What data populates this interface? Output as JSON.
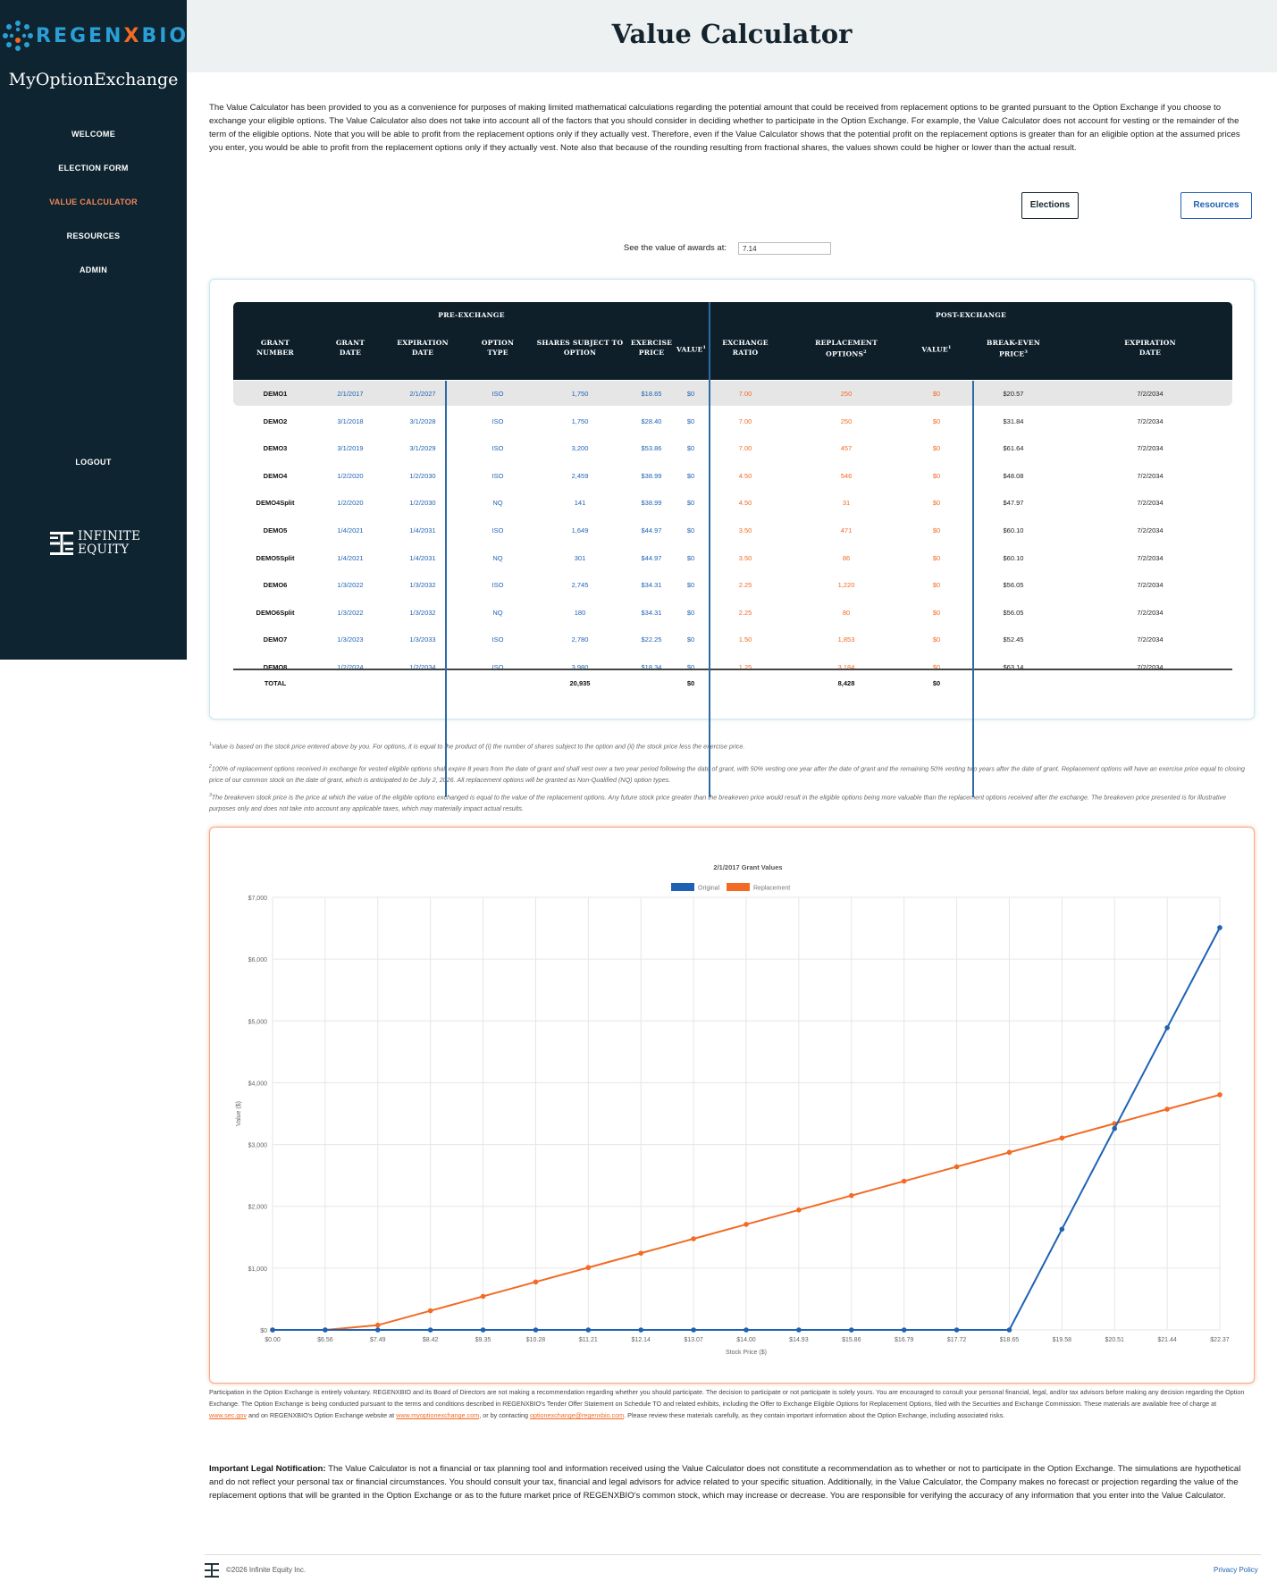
{
  "brand": {
    "logo_text_a": "REGEN",
    "logo_text_b": "X",
    "logo_text_c": "BIO",
    "app_name": "MyOptionExchange",
    "partner_line1": "INFINITE",
    "partner_line2": "EQUITY",
    "accent_blue": "#1f62b4",
    "accent_orange": "#f26a24",
    "sidebar_bg": "#0e2430"
  },
  "nav": {
    "items": [
      {
        "label": "WELCOME",
        "active": false
      },
      {
        "label": "ELECTION FORM",
        "active": false
      },
      {
        "label": "VALUE CALCULATOR",
        "active": true
      },
      {
        "label": "RESOURCES",
        "active": false
      },
      {
        "label": "ADMIN",
        "active": false
      }
    ],
    "logout": "LOGOUT"
  },
  "page": {
    "title": "Value Calculator",
    "intro": "The Value Calculator has been provided to you as a convenience for purposes of making limited mathematical calculations regarding the potential amount that could be received from replacement options to be granted pursuant to the Option Exchange if you choose to exchange your eligible options. The Value Calculator also does not take into account all of the factors that you should consider in deciding whether to participate in the Option Exchange. For example, the Value Calculator does not account for vesting or the remainder of the term of the eligible options. Note that you will be able to profit from the replacement options only if they actually vest. Therefore, even if the Value Calculator shows that the potential profit on the replacement options is greater than for an eligible option at the assumed prices you enter, you would be able to profit from the replacement options only if they actually vest. Note also that because of the rounding resulting from fractional shares, the values shown could be higher or lower than the actual result.",
    "elections_button": "Elections",
    "resources_button": "Resources",
    "see_value_label": "See the value of awards at:",
    "price_value": "7.14"
  },
  "table": {
    "group_pre": "PRE-EXCHANGE",
    "group_post": "POST-EXCHANGE",
    "headers": {
      "grant_number_1": "GRANT",
      "grant_number_2": "NUMBER",
      "grant_date_1": "GRANT",
      "grant_date_2": "DATE",
      "expiration_1": "EXPIRATION",
      "expiration_2": "DATE",
      "option_type_1": "OPTION",
      "option_type_2": "TYPE",
      "shares_1": "SHARES SUBJECT TO",
      "shares_2": "OPTION",
      "exercise_1": "EXERCISE",
      "exercise_2": "PRICE",
      "value_pre": "VALUE",
      "ratio_1": "EXCHANGE",
      "ratio_2": "RATIO",
      "replacement_1": "REPLACEMENT",
      "replacement_2": "OPTIONS",
      "value_post": "VALUE",
      "breakeven_1": "BREAK-EVEN",
      "breakeven_2": "PRICE",
      "post_exp_1": "EXPIRATION",
      "post_exp_2": "DATE"
    },
    "rows": [
      {
        "grant": "DEMO1",
        "grant_date": "2/1/2017",
        "exp_date": "2/1/2027",
        "type": "ISO",
        "shares": "1,750",
        "exercise": "$18.65",
        "value": "$0",
        "ratio": "7.00",
        "replacement": "250",
        "post_value": "$0",
        "breakeven": "$20.57",
        "post_exp": "7/2/2034"
      },
      {
        "grant": "DEMO2",
        "grant_date": "3/1/2018",
        "exp_date": "3/1/2028",
        "type": "ISO",
        "shares": "1,750",
        "exercise": "$28.40",
        "value": "$0",
        "ratio": "7.00",
        "replacement": "250",
        "post_value": "$0",
        "breakeven": "$31.84",
        "post_exp": "7/2/2034"
      },
      {
        "grant": "DEMO3",
        "grant_date": "3/1/2019",
        "exp_date": "3/1/2029",
        "type": "ISO",
        "shares": "3,200",
        "exercise": "$53.86",
        "value": "$0",
        "ratio": "7.00",
        "replacement": "457",
        "post_value": "$0",
        "breakeven": "$61.64",
        "post_exp": "7/2/2034"
      },
      {
        "grant": "DEMO4",
        "grant_date": "1/2/2020",
        "exp_date": "1/2/2030",
        "type": "ISO",
        "shares": "2,459",
        "exercise": "$38.99",
        "value": "$0",
        "ratio": "4.50",
        "replacement": "546",
        "post_value": "$0",
        "breakeven": "$48.08",
        "post_exp": "7/2/2034"
      },
      {
        "grant": "DEMO4Split",
        "grant_date": "1/2/2020",
        "exp_date": "1/2/2030",
        "type": "NQ",
        "shares": "141",
        "exercise": "$38.99",
        "value": "$0",
        "ratio": "4.50",
        "replacement": "31",
        "post_value": "$0",
        "breakeven": "$47.97",
        "post_exp": "7/2/2034"
      },
      {
        "grant": "DEMO5",
        "grant_date": "1/4/2021",
        "exp_date": "1/4/2031",
        "type": "ISO",
        "shares": "1,649",
        "exercise": "$44.97",
        "value": "$0",
        "ratio": "3.50",
        "replacement": "471",
        "post_value": "$0",
        "breakeven": "$60.10",
        "post_exp": "7/2/2034"
      },
      {
        "grant": "DEMO5Split",
        "grant_date": "1/4/2021",
        "exp_date": "1/4/2031",
        "type": "NQ",
        "shares": "301",
        "exercise": "$44.97",
        "value": "$0",
        "ratio": "3.50",
        "replacement": "86",
        "post_value": "$0",
        "breakeven": "$60.10",
        "post_exp": "7/2/2034"
      },
      {
        "grant": "DEMO6",
        "grant_date": "1/3/2022",
        "exp_date": "1/3/2032",
        "type": "ISO",
        "shares": "2,745",
        "exercise": "$34.31",
        "value": "$0",
        "ratio": "2.25",
        "replacement": "1,220",
        "post_value": "$0",
        "breakeven": "$56.05",
        "post_exp": "7/2/2034"
      },
      {
        "grant": "DEMO6Split",
        "grant_date": "1/3/2022",
        "exp_date": "1/3/2032",
        "type": "NQ",
        "shares": "180",
        "exercise": "$34.31",
        "value": "$0",
        "ratio": "2.25",
        "replacement": "80",
        "post_value": "$0",
        "breakeven": "$56.05",
        "post_exp": "7/2/2034"
      },
      {
        "grant": "DEMO7",
        "grant_date": "1/3/2023",
        "exp_date": "1/3/2033",
        "type": "ISO",
        "shares": "2,780",
        "exercise": "$22.25",
        "value": "$0",
        "ratio": "1.50",
        "replacement": "1,853",
        "post_value": "$0",
        "breakeven": "$52.45",
        "post_exp": "7/2/2034"
      },
      {
        "grant": "DEMO8",
        "grant_date": "1/2/2024",
        "exp_date": "1/2/2034",
        "type": "ISO",
        "shares": "3,980",
        "exercise": "$18.34",
        "value": "$0",
        "ratio": "1.25",
        "replacement": "3,184",
        "post_value": "$0",
        "breakeven": "$63.14",
        "post_exp": "7/2/2034"
      }
    ],
    "total": {
      "label": "TOTAL",
      "shares": "20,935",
      "value": "$0",
      "replacement": "8,428",
      "post_value": "$0"
    }
  },
  "footnotes": {
    "n1": "Value is based on the stock price entered above by you. For options, it is equal to the product of (i) the number of shares subject to the option and (ii) the stock price less the exercise price.",
    "n2": "100% of replacement options received in exchange for vested eligible options shall expire 8 years from the date of grant and shall vest over a two year period following the date of grant, with 50% vesting one year after the date of grant and the remaining 50% vesting two years after the date of grant. Replacement options will have an exercise price equal to closing price of our common stock on the date of grant, which is anticipated to be July 2, 2026. All replacement options will be granted as Non-Qualified (NQ) option types.",
    "n3": "The breakeven stock price is the price at which the value of the eligible options exchanged is equal to the value of the replacement options. Any future stock price greater than the breakeven price would result in the eligible options being more valuable than the replacement options received after the exchange. The breakeven price presented is for illustrative purposes only and does not take into account any applicable taxes, which may materially impact actual results."
  },
  "chart_data": {
    "type": "line",
    "title": "2/1/2017 Grant Values",
    "xlabel": "Stock Price ($)",
    "ylabel": "Value ($)",
    "x": [
      "$0.00",
      "$6.56",
      "$7.49",
      "$8.42",
      "$9.35",
      "$10.28",
      "$11.21",
      "$12.14",
      "$13.07",
      "$14.00",
      "$14.93",
      "$15.86",
      "$16.79",
      "$17.72",
      "$18.65",
      "$19.58",
      "$20.51",
      "$21.44",
      "$22.37"
    ],
    "yticks": [
      "$0",
      "$1,000",
      "$2,000",
      "$3,000",
      "$4,000",
      "$5,000",
      "$6,000",
      "$7,000"
    ],
    "ylim": [
      0,
      7000
    ],
    "grid": true,
    "legend": "top",
    "series": [
      {
        "name": "Original",
        "color": "#1f62b4",
        "values": [
          0,
          0,
          0,
          0,
          0,
          0,
          0,
          0,
          0,
          0,
          0,
          0,
          0,
          0,
          0,
          1630,
          3260,
          4890,
          6510
        ]
      },
      {
        "name": "Replacement",
        "color": "#f26a24",
        "values": [
          0,
          0,
          77,
          310,
          543,
          776,
          1009,
          1242,
          1475,
          1708,
          1941,
          2174,
          2407,
          2640,
          2873,
          3106,
          3339,
          3572,
          3805
        ]
      }
    ]
  },
  "participation": {
    "text_a": "Participation in the Option Exchange is entirely voluntary. REGENXBIO and its Board of Directors are not making a recommendation regarding whether you should participate. The decision to participate or not participate is solely yours. You are encouraged to consult your personal financial, legal, and/or tax advisors before making any decision regarding the Option Exchange. The Option Exchange is being conducted pursuant to the terms and conditions described in REGENXBIO's Tender Offer Statement on Schedule TO and related exhibits, including the Offer to Exchange Eligible Options for Replacement Options, filed with the Securities and Exchange Commission. These materials are available free of charge at ",
    "link_sec": "www.sec.gov",
    "text_b": " and on REGENXBIO's Option Exchange website at ",
    "link_site": "www.myoptionexchange.com",
    "text_c": ", or by contacting ",
    "link_email": "optionexchange@regenxbio.com",
    "text_d": ". Please review these materials carefully, as they contain important information about the Option Exchange, including associated risks."
  },
  "legal": {
    "heading": "Important Legal Notification:",
    "body": " The Value Calculator is not a financial or tax planning tool and information received using the Value Calculator does not constitute a recommendation as to whether or not to participate in the Option Exchange. The simulations are hypothetical and do not reflect your personal tax or financial circumstances. You should consult your tax, financial and legal advisors for advice related to your specific situation. Additionally, in the Value Calculator, the Company makes no forecast or projection regarding the value of the replacement options that will be granted in the Option Exchange or as to the future market price of REGENXBIO's common stock, which may increase or decrease. You are responsible for verifying the accuracy of any information that you enter into the Value Calculator."
  },
  "footer": {
    "copyright": "©2026 Infinite Equity Inc.",
    "privacy": "Privacy Policy"
  }
}
